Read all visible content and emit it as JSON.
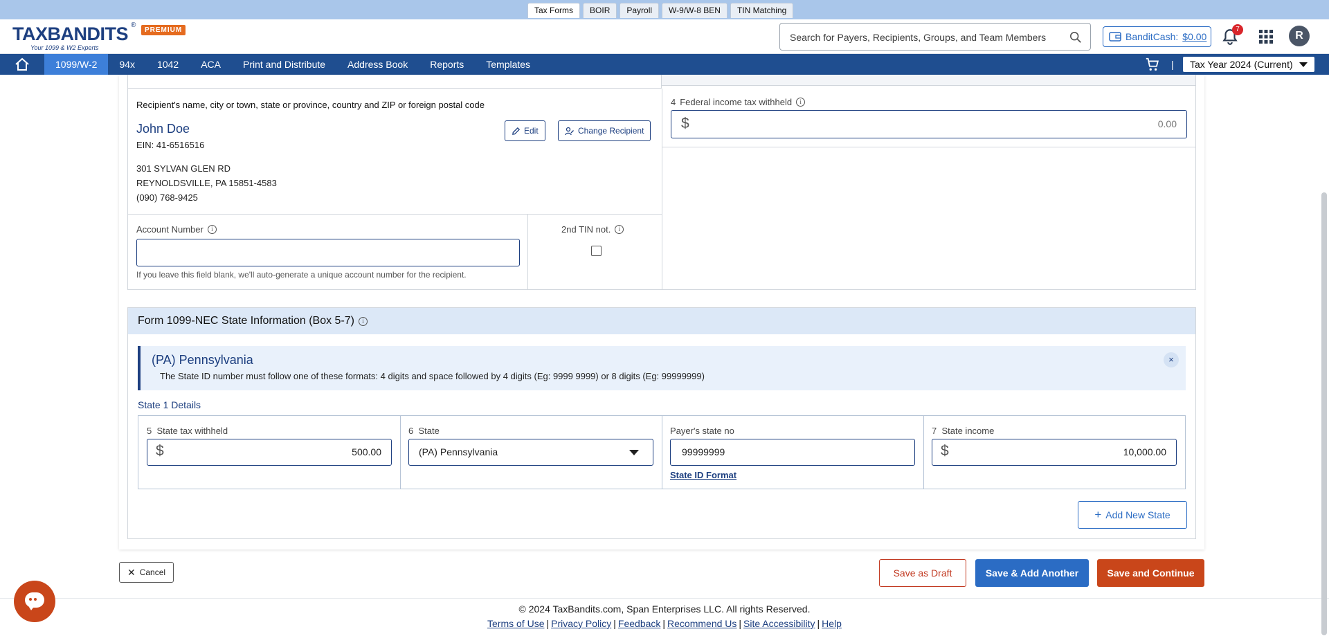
{
  "product_tabs": [
    "Tax Forms",
    "BOIR",
    "Payroll",
    "W-9/W-8 BEN",
    "TIN Matching"
  ],
  "header": {
    "logo_text_a": "TAX",
    "logo_text_b": "BANDITS",
    "logo_tagline": "Your 1099 & W2 Experts",
    "premium_badge": "PREMIUM",
    "search_placeholder": "Search for Payers, Recipients, Groups, and Team Members",
    "bandit_cash_label": "BanditCash:",
    "bandit_cash_amount": "$0.00",
    "notification_count": "7",
    "avatar_initial": "R"
  },
  "nav": {
    "items": [
      "1099/W-2",
      "94x",
      "1042",
      "ACA",
      "Print and Distribute",
      "Address Book",
      "Reports",
      "Templates"
    ],
    "active_item": "1099/W-2",
    "tax_year": "Tax Year 2024 (Current)",
    "separator": "|"
  },
  "recipient": {
    "section_label": "Recipient's name, city or town, state or province, country and ZIP or foreign postal code",
    "name": "John Doe",
    "ein": "EIN: 41-6516516",
    "address_line1": "301 SYLVAN GLEN RD",
    "address_line2": "REYNOLDSVILLE, PA 15851-4583",
    "phone": "(090) 768-9425",
    "edit_label": "Edit",
    "change_label": "Change Recipient",
    "account_number_label": "Account Number",
    "account_number_value": "",
    "account_number_hint": "If you leave this field blank, we'll auto-generate a unique account number for the recipient.",
    "second_tin_label": "2nd TIN not.",
    "second_tin_checked": false
  },
  "federal": {
    "box_number": "4",
    "label": "Federal income tax withheld",
    "currency": "$",
    "value": "0.00"
  },
  "state_info": {
    "title": "Form 1099-NEC  State Information  (Box 5-7)",
    "banner_title": "(PA) Pennsylvania",
    "banner_text": "The State ID number must follow one of these formats: 4 digits and space followed by 4 digits (Eg: 9999 9999) or 8 digits (Eg: 99999999)",
    "banner_close": "×",
    "details_label": "State 1 Details",
    "state_tax_box": "5",
    "state_tax_label": "State tax withheld",
    "state_tax_value": "500.00",
    "state_box": "6",
    "state_label": "State",
    "state_value": "(PA) Pennsylvania",
    "payer_state_no_label": "Payer's state no",
    "payer_state_no_value": "99999999",
    "state_id_format_link": "State ID Format",
    "state_income_box": "7",
    "state_income_label": "State income",
    "state_income_value": "10,000.00",
    "currency": "$",
    "add_state_label": "Add New State"
  },
  "actions": {
    "cancel": "Cancel",
    "save_draft": "Save as Draft",
    "save_add_another": "Save & Add Another",
    "save_continue": "Save and Continue"
  },
  "footer": {
    "copyright": "© 2024 TaxBandits.com, Span Enterprises LLC. All rights Reserved.",
    "links": [
      "Terms of Use",
      "Privacy Policy",
      "Feedback",
      "Recommend Us",
      "Site Accessibility",
      "Help"
    ]
  },
  "colors": {
    "brand_navy": "#1d3f80",
    "nav_bg": "#1f4e90",
    "nav_active": "#3d7fd9",
    "accent_orange": "#c9461a",
    "primary_blue": "#2b6cc4",
    "state_header_bg": "#dce8f7"
  }
}
